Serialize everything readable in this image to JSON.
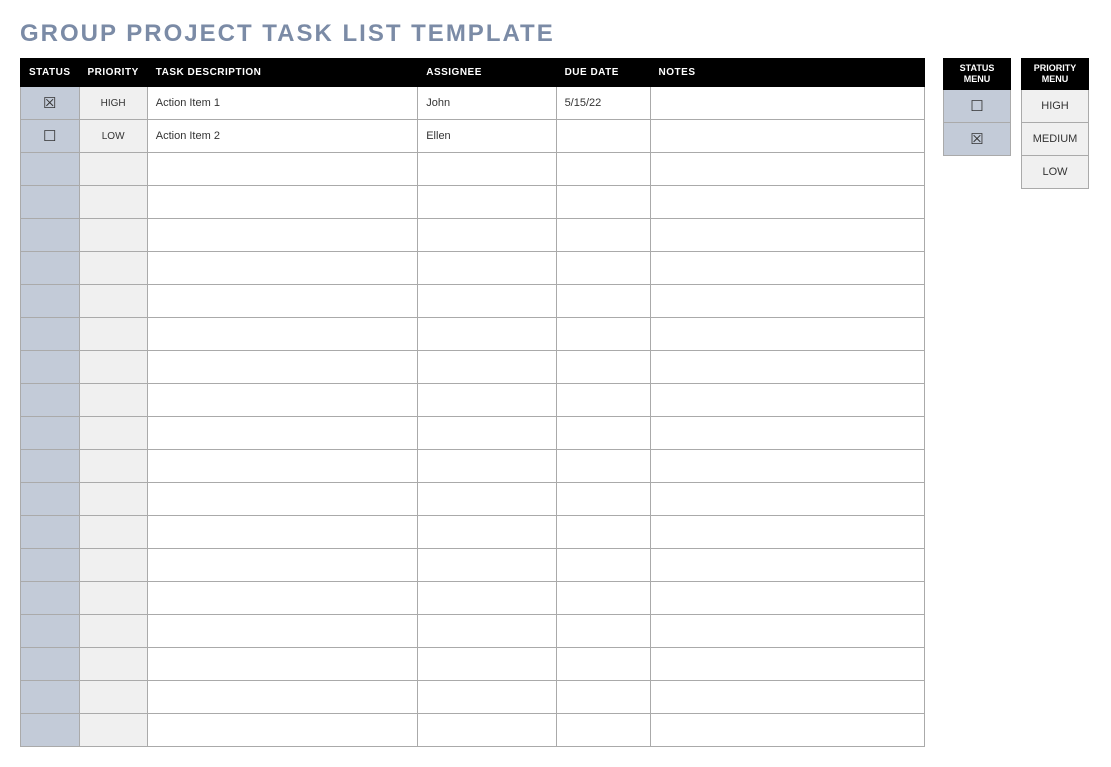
{
  "title": "GROUP PROJECT TASK LIST TEMPLATE",
  "headers": {
    "status": "STATUS",
    "priority": "PRIORITY",
    "task": "TASK DESCRIPTION",
    "assignee": "ASSIGNEE",
    "due": "DUE DATE",
    "notes": "NOTES"
  },
  "rows": [
    {
      "status": "☒",
      "priority": "HIGH",
      "task": "Action Item 1",
      "assignee": "John",
      "due": "5/15/22",
      "notes": ""
    },
    {
      "status": "☐",
      "priority": "LOW",
      "task": "Action Item 2",
      "assignee": "Ellen",
      "due": "",
      "notes": ""
    },
    {
      "status": "",
      "priority": "",
      "task": "",
      "assignee": "",
      "due": "",
      "notes": ""
    },
    {
      "status": "",
      "priority": "",
      "task": "",
      "assignee": "",
      "due": "",
      "notes": ""
    },
    {
      "status": "",
      "priority": "",
      "task": "",
      "assignee": "",
      "due": "",
      "notes": ""
    },
    {
      "status": "",
      "priority": "",
      "task": "",
      "assignee": "",
      "due": "",
      "notes": ""
    },
    {
      "status": "",
      "priority": "",
      "task": "",
      "assignee": "",
      "due": "",
      "notes": ""
    },
    {
      "status": "",
      "priority": "",
      "task": "",
      "assignee": "",
      "due": "",
      "notes": ""
    },
    {
      "status": "",
      "priority": "",
      "task": "",
      "assignee": "",
      "due": "",
      "notes": ""
    },
    {
      "status": "",
      "priority": "",
      "task": "",
      "assignee": "",
      "due": "",
      "notes": ""
    },
    {
      "status": "",
      "priority": "",
      "task": "",
      "assignee": "",
      "due": "",
      "notes": ""
    },
    {
      "status": "",
      "priority": "",
      "task": "",
      "assignee": "",
      "due": "",
      "notes": ""
    },
    {
      "status": "",
      "priority": "",
      "task": "",
      "assignee": "",
      "due": "",
      "notes": ""
    },
    {
      "status": "",
      "priority": "",
      "task": "",
      "assignee": "",
      "due": "",
      "notes": ""
    },
    {
      "status": "",
      "priority": "",
      "task": "",
      "assignee": "",
      "due": "",
      "notes": ""
    },
    {
      "status": "",
      "priority": "",
      "task": "",
      "assignee": "",
      "due": "",
      "notes": ""
    },
    {
      "status": "",
      "priority": "",
      "task": "",
      "assignee": "",
      "due": "",
      "notes": ""
    },
    {
      "status": "",
      "priority": "",
      "task": "",
      "assignee": "",
      "due": "",
      "notes": ""
    },
    {
      "status": "",
      "priority": "",
      "task": "",
      "assignee": "",
      "due": "",
      "notes": ""
    },
    {
      "status": "",
      "priority": "",
      "task": "",
      "assignee": "",
      "due": "",
      "notes": ""
    }
  ],
  "statusMenu": {
    "header": "STATUS MENU",
    "items": [
      "☐",
      "☒"
    ]
  },
  "priorityMenu": {
    "header": "PRIORITY MENU",
    "items": [
      "HIGH",
      "MEDIUM",
      "LOW"
    ]
  }
}
